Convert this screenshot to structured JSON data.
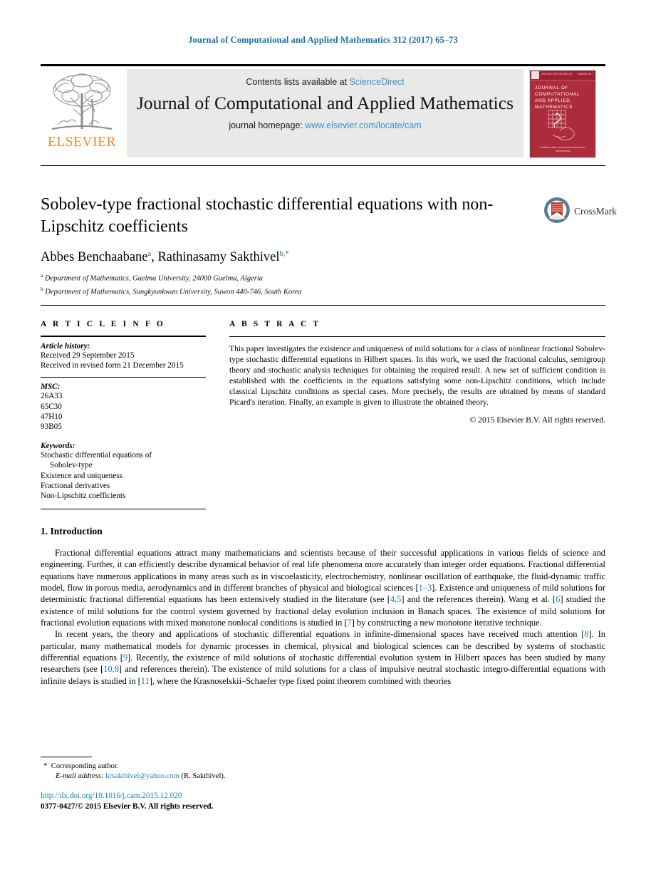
{
  "running_head": "Journal of Computational and Applied Mathematics 312 (2017) 65–73",
  "masthead": {
    "contents_prefix": "Contents lists available at ",
    "sciencedirect": "ScienceDirect",
    "journal_name": "Journal of Computational and Applied Mathematics",
    "homepage_prefix": "journal homepage: ",
    "homepage_url": "www.elsevier.com/locate/cam",
    "publisher_logo_text": "ELSEVIER",
    "cover": {
      "title": "JOURNAL OF COMPUTATIONAL AND APPLIED MATHEMATICS",
      "topbar_left": "ISSN 0377-0427",
      "topbar_mid": "VOLUME 312",
      "topbar_right": "1 MARCH 2017",
      "footer_line1": "Available online at www.sciencedirect.com",
      "footer_line2": "ScienceDirect"
    }
  },
  "article": {
    "title": "Sobolev-type fractional stochastic differential equations with non-Lipschitz coefficients",
    "crossmark_label": "CrossMark",
    "authors": [
      {
        "name": "Abbes Benchaabane",
        "marker": "a"
      },
      {
        "name": "Rathinasamy Sakthivel",
        "marker": "b",
        "corresponding": "*"
      }
    ],
    "affiliations": [
      {
        "marker": "a",
        "text": "Department of Mathematics, Guelma University, 24000 Guelma, Algeria"
      },
      {
        "marker": "b",
        "text": "Department of Mathematics, Sungkyunkwan University, Suwon 440-746, South Korea"
      }
    ]
  },
  "info": {
    "heading": "A R T I C L E   I N F O",
    "history_label": "Article history:",
    "history": [
      "Received 29 September 2015",
      "Received in revised form 21 December 2015"
    ],
    "msc_label": "MSC:",
    "msc": [
      "26A33",
      "65C30",
      "47H10",
      "93B05"
    ],
    "keywords_label": "Keywords:",
    "keywords": [
      "Stochastic differential equations of",
      "Sobolev-type",
      "Existence and uniqueness",
      "Fractional derivatives",
      "Non-Lipschitz coefficients"
    ]
  },
  "abstract": {
    "heading": "A B S T R A C T",
    "text": "This paper investigates the existence and uniqueness of mild solutions for a class of nonlinear fractional Sobolev-type stochastic differential equations in Hilbert spaces. In this work, we used the fractional calculus, semigroup theory and stochastic analysis techniques for obtaining the required result. A new set of sufficient condition is established with the coefficients in the equations satisfying some non-Lipschitz conditions, which include classical Lipschitz conditions as special cases. More precisely, the results are obtained by means of standard Picard's iteration. Finally, an example is given to illustrate the obtained theory.",
    "copyright": "© 2015 Elsevier B.V. All rights reserved."
  },
  "body": {
    "section_title": "1. Introduction",
    "paragraph1_part1": "Fractional differential equations attract many mathematicians and scientists because of their successful applications in various fields of science and engineering. Further, it can efficiently describe dynamical behavior of real life phenomena more accurately than integer order equations. Fractional differential equations have numerous applications in many areas such as in viscoelasticity, electrochemistry, nonlinear oscillation of earthquake, the fluid-dynamic traffic model, flow in porous media, aerodynamics and in different branches of physical and biological sciences [",
    "ref_1_3": "1–3",
    "paragraph1_part2": "]. Existence and uniqueness of mild solutions for deterministic fractional differential equations has been extensively studied in the literature (see [",
    "ref_4_5": "4,5",
    "paragraph1_part3": "] and the references therein). Wang et al. [",
    "ref_6": "6",
    "paragraph1_part4": "] studied the existence of mild solutions for the control system governed by fractional delay evolution inclusion in Banach spaces. The existence of mild solutions for fractional evolution equations with mixed monotone nonlocal conditions is studied in [",
    "ref_7": "7",
    "paragraph1_part5": "] by constructing a new monotone iterative technique.",
    "paragraph2_part1": "In recent years, the theory and applications of stochastic differential equations in infinite-dimensional spaces have received much attention [",
    "ref_8": "8",
    "paragraph2_part2": "]. In particular, many mathematical models for dynamic processes in chemical, physical and biological sciences can be described by systems of stochastic differential equations [",
    "ref_9": "9",
    "paragraph2_part3": "]. Recently, the existence of mild solutions of stochastic differential evolution system in Hilbert spaces has been studied by many researchers (see [",
    "ref_10_8": "10,8",
    "paragraph2_part4": "] and references therein). The existence of mild solutions for a class of impulsive neutral stochastic integro-differential equations with infinite delays is studied in [",
    "ref_11": "11",
    "paragraph2_part5": "], where the Krasnoselskii–Schaefer type fixed point theorem combined with theories"
  },
  "footer": {
    "corresponding_star": "*",
    "corresponding_label": "Corresponding author.",
    "email_label": "E-mail address:",
    "email": "krsakthivel@yahoo.com",
    "email_owner": "(R. Sakthivel).",
    "doi": "http://dx.doi.org/10.1016/j.cam.2015.12.020",
    "issn_line": "0377-0427/© 2015 Elsevier B.V. All rights reserved."
  },
  "colors": {
    "link_blue": "#3a8fc4",
    "ref_blue": "#1a7fb5",
    "runhead_blue": "#1a6fa3",
    "elsevier_orange": "#eb8a2f",
    "masthead_gray": "#e9e9e9",
    "cover_red": "#ad2c3c"
  }
}
